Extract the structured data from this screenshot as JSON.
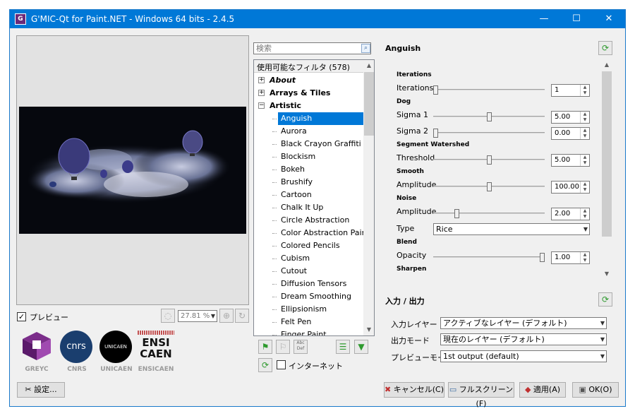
{
  "window": {
    "title": "G'MIC-Qt for Paint.NET - Windows 64 bits - 2.4.5",
    "minimize": "—",
    "maximize": "☐",
    "close": "✕"
  },
  "preview": {
    "checkbox_label": "プレビュー",
    "checked": true,
    "zoom": "27.81 %"
  },
  "logos": [
    "GREYC",
    "CNRS",
    "UNICAEN",
    "ENSICAEN"
  ],
  "logo_text": {
    "cnrs": "cnrs",
    "unicaen": "UNICAEN",
    "ensicaen": "ENSI CAEN"
  },
  "settings_button": "設定...",
  "search": {
    "placeholder": "検索"
  },
  "filter_tree": {
    "header": "使用可能なフィルタ (578)",
    "categories": [
      {
        "label": "About",
        "expander": "+",
        "italic": true
      },
      {
        "label": "Arrays & Tiles",
        "expander": "+"
      },
      {
        "label": "Artistic",
        "expander": "−"
      }
    ],
    "items": [
      "Anguish",
      "Aurora",
      "Black Crayon Graffiti",
      "Blockism",
      "Bokeh",
      "Brushify",
      "Cartoon",
      "Chalk It Up",
      "Circle Abstraction",
      "Color Abstraction Paint",
      "Colored Pencils",
      "Cubism",
      "Cutout",
      "Diffusion Tensors",
      "Dream Smoothing",
      "Ellipsionism",
      "Felt Pen",
      "Finger Paint"
    ],
    "selected": "Anguish"
  },
  "internet_label": "インターネット",
  "filter_panel": {
    "title": "Anguish",
    "sections": {
      "iterations": "Iterations",
      "dog": "Dog",
      "segment_watershed": "Segment Watershed",
      "smooth": "Smooth",
      "noise": "Noise",
      "blend": "Blend",
      "sharpen": "Sharpen"
    },
    "params": {
      "iterations": {
        "label": "Iterations",
        "value": "1",
        "fraction": 0.0
      },
      "sigma1": {
        "label": "Sigma 1",
        "value": "5.00",
        "fraction": 0.5
      },
      "sigma2": {
        "label": "Sigma 2",
        "value": "0.00",
        "fraction": 0.0
      },
      "threshold": {
        "label": "Threshold",
        "value": "5.00",
        "fraction": 0.5
      },
      "smooth_amplitude": {
        "label": "Amplitude",
        "value": "100.00",
        "fraction": 0.5
      },
      "noise_amplitude": {
        "label": "Amplitude",
        "value": "2.00",
        "fraction": 0.2
      },
      "type": {
        "label": "Type",
        "value": "Rice"
      },
      "opacity": {
        "label": "Opacity",
        "value": "1.00",
        "fraction": 1.0
      }
    }
  },
  "io": {
    "title": "入力 / 出力",
    "input_layer_label": "入力レイヤー",
    "input_layer_value": "アクティブなレイヤー (デフォルト)",
    "output_mode_label": "出力モード",
    "output_mode_value": "現在のレイヤー (デフォルト)",
    "preview_mode_label": "プレビューモード",
    "preview_mode_value": "1st output (default)"
  },
  "buttons": {
    "cancel": "キャンセル(C)",
    "fullscreen": "フルスクリーン(F)",
    "apply": "適用(A)",
    "ok": "OK(O)"
  },
  "colors": {
    "titlebar": "#0078d7",
    "selection": "#0078d7",
    "refresh_green": "#2e9a2e"
  }
}
